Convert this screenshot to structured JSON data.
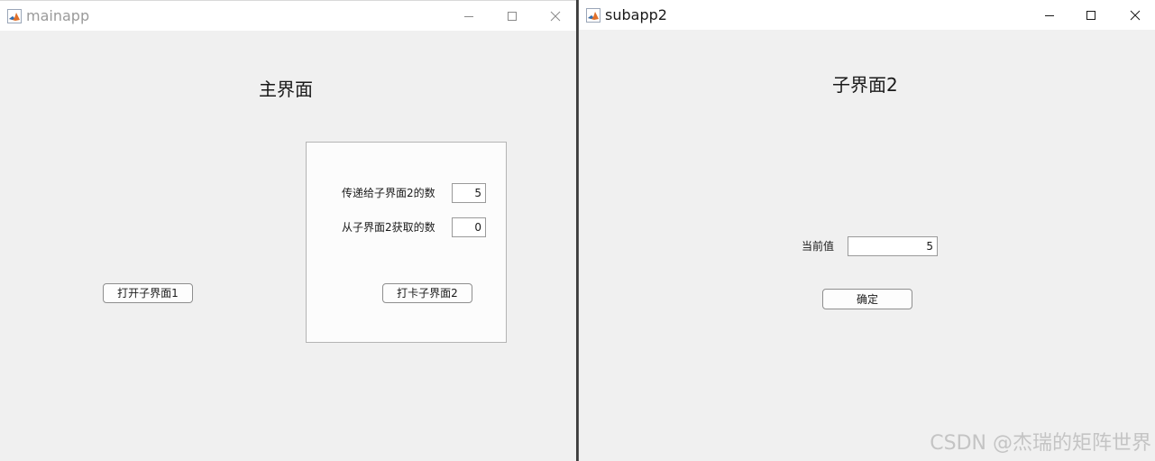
{
  "main_window": {
    "title": "mainapp",
    "heading": "主界面",
    "open_sub1_button": "打开子界面1",
    "panel": {
      "send_label": "传递给子界面2的数",
      "send_value": "5",
      "receive_label": "从子界面2获取的数",
      "receive_value": "0",
      "open_sub2_button": "打卡子界面2"
    }
  },
  "sub_window": {
    "title": "subapp2",
    "heading": "子界面2",
    "current_label": "当前值",
    "current_value": "5",
    "confirm_button": "确定"
  },
  "watermark": "CSDN @杰瑞的矩阵世界",
  "icons": {
    "app": "matlab-icon",
    "minimize": "minimize-icon",
    "maximize": "maximize-icon",
    "close": "close-icon"
  },
  "colors": {
    "window_bg": "#f0f0f0",
    "titlebar_bg": "#ffffff",
    "inactive_title": "#9a9a9a"
  }
}
